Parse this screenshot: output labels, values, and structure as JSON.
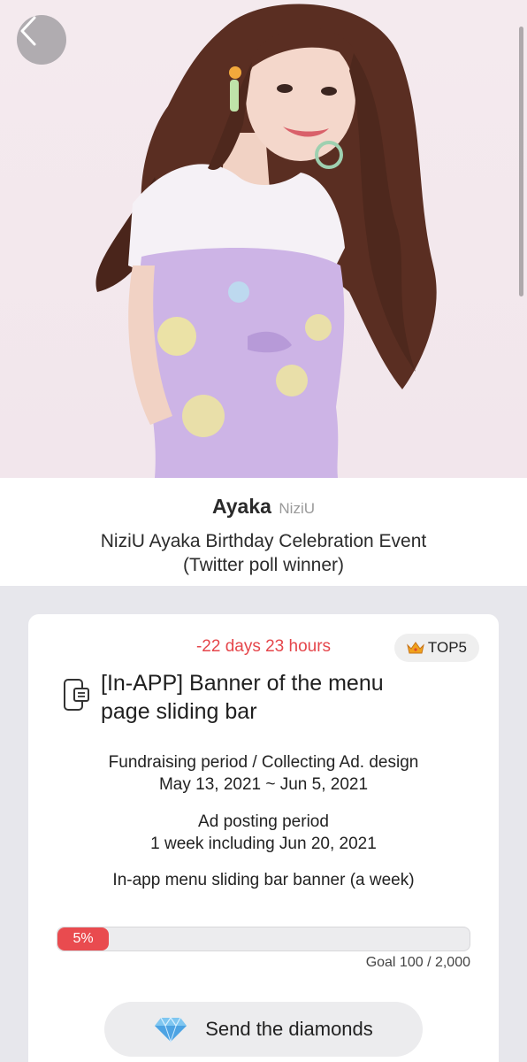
{
  "artist": {
    "name": "Ayaka",
    "group": "NiziU"
  },
  "event": {
    "title_line1": "NiziU Ayaka Birthday Celebration Event",
    "title_line2": "(Twitter poll winner)"
  },
  "card": {
    "countdown": "-22 days 23 hours",
    "rank_badge": "TOP5",
    "ad_title_line1": "[In-APP] Banner of the menu",
    "ad_title_line2": "page sliding bar",
    "fundraising_label": "Fundraising period / Collecting Ad. design",
    "fundraising_dates": "May 13, 2021 ~ Jun 5, 2021",
    "posting_label": "Ad posting period",
    "posting_dates": "1 week including Jun 20, 2021",
    "product": "In-app menu sliding bar banner (a week)",
    "progress_percent_text": "5%",
    "progress_fraction": 0.05,
    "goal": "Goal 100 / 2,000",
    "send_label": "Send the diamonds"
  },
  "colors": {
    "accent_red": "#e94b4f",
    "countdown_red": "#e5464b",
    "background": "#e7e7ec"
  },
  "icons": {
    "back": "chevron-left-icon",
    "crown": "crown-icon",
    "ad": "mobile-ad-icon",
    "diamond": "diamond-icon"
  }
}
